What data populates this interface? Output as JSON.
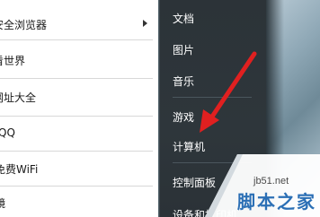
{
  "programs": {
    "items": [
      {
        "label": "安全浏览器",
        "has_submenu": true
      },
      {
        "label": "看世界",
        "has_submenu": false
      },
      {
        "label": "网址大全",
        "has_submenu": false
      },
      {
        "label": "QQ",
        "has_submenu": false
      },
      {
        "label": "免费WiFi",
        "has_submenu": false
      },
      {
        "label": "镜",
        "has_submenu": false
      }
    ]
  },
  "places": {
    "items": [
      {
        "label": "文档"
      },
      {
        "label": "图片"
      },
      {
        "label": "音乐"
      },
      {
        "label": "游戏"
      },
      {
        "label": "计算机"
      },
      {
        "label": "控制面板"
      },
      {
        "label": "设备和打印机"
      }
    ]
  },
  "watermark": {
    "domain": "jb51.net",
    "title": "脚本之家"
  },
  "colors": {
    "arrow": "#e02020",
    "watermark_blue": "#2b6fb5",
    "panel_dark": "#2e363b"
  }
}
